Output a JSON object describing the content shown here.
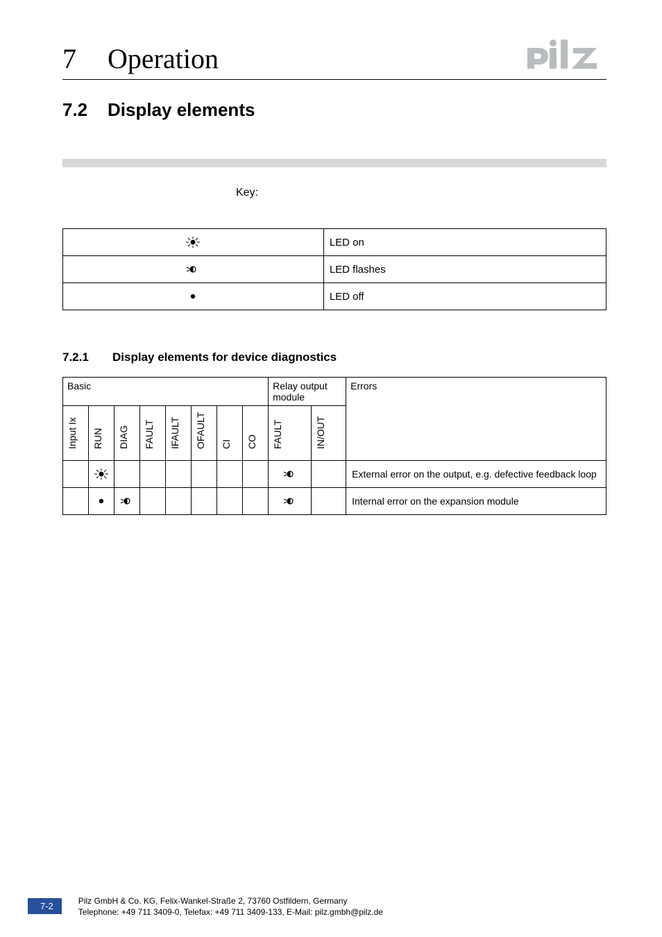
{
  "header": {
    "chapter_number": "7",
    "chapter_title": "Operation",
    "logo_alt": "pilz"
  },
  "section": {
    "number": "7.2",
    "title": "Display elements"
  },
  "key": {
    "label": "Key:",
    "rows": [
      {
        "symbol": "led-on",
        "desc": "LED on"
      },
      {
        "symbol": "led-flash",
        "desc": "LED flashes"
      },
      {
        "symbol": "led-off",
        "desc": "LED off"
      }
    ]
  },
  "subsection": {
    "number": "7.2.1",
    "title": "Display elements for device diagnostics"
  },
  "diag_table": {
    "group_headers": {
      "basic": "Basic",
      "relay": "Relay output module",
      "errors": "Errors"
    },
    "columns_basic": [
      "Input Ix",
      "RUN",
      "DIAG",
      "FAULT",
      "IFAULT",
      "OFAULT",
      "CI",
      "CO"
    ],
    "columns_relay": [
      "FAULT",
      "IN/OUT"
    ],
    "rows": [
      {
        "basic": [
          "",
          "led-on",
          "",
          "",
          "",
          "",
          "",
          ""
        ],
        "relay": [
          "led-flash",
          ""
        ],
        "error": "External error on the output, e.g. defective feedback loop"
      },
      {
        "basic": [
          "",
          "led-off",
          "led-flash",
          "",
          "",
          "",
          "",
          ""
        ],
        "relay": [
          "led-flash",
          ""
        ],
        "error": "Internal error on the expansion module"
      }
    ]
  },
  "footer": {
    "page": "7-2",
    "line1": "Pilz GmbH & Co. KG, Felix-Wankel-Straße 2, 73760 Ostfildern, Germany",
    "line2": "Telephone: +49 711 3409-0, Telefax: +49 711 3409-133, E-Mail: pilz.gmbh@pilz.de"
  }
}
